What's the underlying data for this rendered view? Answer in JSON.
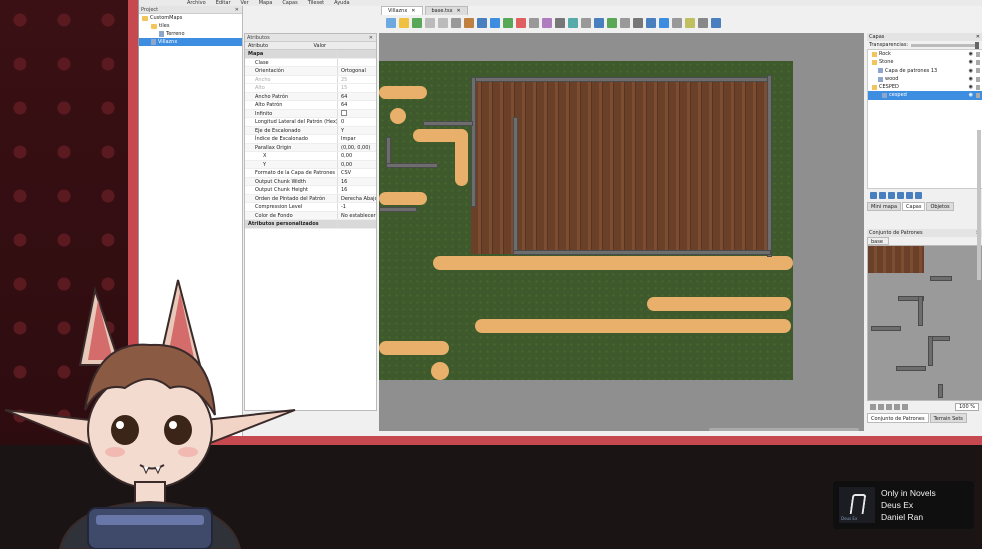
{
  "menu": [
    "Archivo",
    "Editar",
    "Ver",
    "Mapa",
    "Capas",
    "Tileset",
    "Ayuda"
  ],
  "project": {
    "header": "Project",
    "items": [
      {
        "label": "CustomMaps",
        "icon": "folder-icon"
      },
      {
        "label": "tiles",
        "icon": "folder-icon"
      },
      {
        "label": "Terreno",
        "icon": "file-icon"
      },
      {
        "label": "Villaznx",
        "icon": "map-icon"
      }
    ]
  },
  "tabs": [
    {
      "label": "Villaznx"
    },
    {
      "label": "base.tsx"
    }
  ],
  "attributes": {
    "header": "Atributos",
    "col_name": "Atributo",
    "col_value": "Valor",
    "rows": [
      {
        "k": "Mapa",
        "v": "",
        "type": "group"
      },
      {
        "k": "Clase",
        "v": "",
        "type": ""
      },
      {
        "k": "Orientación",
        "v": "Ortogonal",
        "type": "alt"
      },
      {
        "k": "Ancho",
        "v": "25",
        "type": "dim"
      },
      {
        "k": "Alto",
        "v": "15",
        "type": "dim"
      },
      {
        "k": "Ancho Patrón",
        "v": "64",
        "type": "alt"
      },
      {
        "k": "Alto Patrón",
        "v": "64",
        "type": ""
      },
      {
        "k": "Infinito",
        "v": "",
        "type": "alt check"
      },
      {
        "k": "Longitud Lateral del Patrón (Hex)",
        "v": "0",
        "type": ""
      },
      {
        "k": "Eje de Escalonado",
        "v": "Y",
        "type": "alt"
      },
      {
        "k": "Índice de Escalonado",
        "v": "Impar",
        "type": ""
      },
      {
        "k": "Parallax Origin",
        "v": "(0,00, 0,00)",
        "type": "alt"
      },
      {
        "k": "X",
        "v": "0,00",
        "type": "sub"
      },
      {
        "k": "Y",
        "v": "0,00",
        "type": "sub alt"
      },
      {
        "k": "Formato de la Capa de Patrones",
        "v": "CSV",
        "type": ""
      },
      {
        "k": "Output Chunk Width",
        "v": "16",
        "type": "alt"
      },
      {
        "k": "Output Chunk Height",
        "v": "16",
        "type": ""
      },
      {
        "k": "Orden de Pintado del Patrón",
        "v": "Derecha Abajo",
        "type": "alt"
      },
      {
        "k": "Compression Level",
        "v": "-1",
        "type": ""
      },
      {
        "k": "Color de Fondo",
        "v": "No establecer",
        "type": "alt"
      },
      {
        "k": "Atributos personalizados",
        "v": "",
        "type": "group"
      }
    ]
  },
  "layers": {
    "header": "Capas",
    "opacity_label": "Transparencias:",
    "items": [
      {
        "label": "Rock",
        "icon": "folder-icon"
      },
      {
        "label": "Stone",
        "icon": "folder-icon"
      },
      {
        "label": "Capa de patrones 13",
        "icon": "layer-icon"
      },
      {
        "label": "wood",
        "icon": "layer-icon"
      },
      {
        "label": "CESPED",
        "icon": "folder-icon"
      },
      {
        "label": "cesped",
        "icon": "layer-icon",
        "selected": true
      }
    ],
    "tabs": [
      "Mini mapa",
      "Capas",
      "Objetos"
    ]
  },
  "tileset": {
    "header": "Conjunto de Patrones",
    "tab": "base",
    "zoom": "100 %",
    "bottom_tabs": [
      "Conjunto de Patrones",
      "Terrain Sets"
    ]
  },
  "now_playing": {
    "art_text": "Deus Ex",
    "title": "Only in Novels",
    "album": "Deus Ex",
    "artist": "Daniel Ran"
  },
  "colors": {
    "accent": "#3d8ee0",
    "frame": "#c6494f",
    "grass": "#3e5a2c",
    "path": "#e8b06a"
  }
}
